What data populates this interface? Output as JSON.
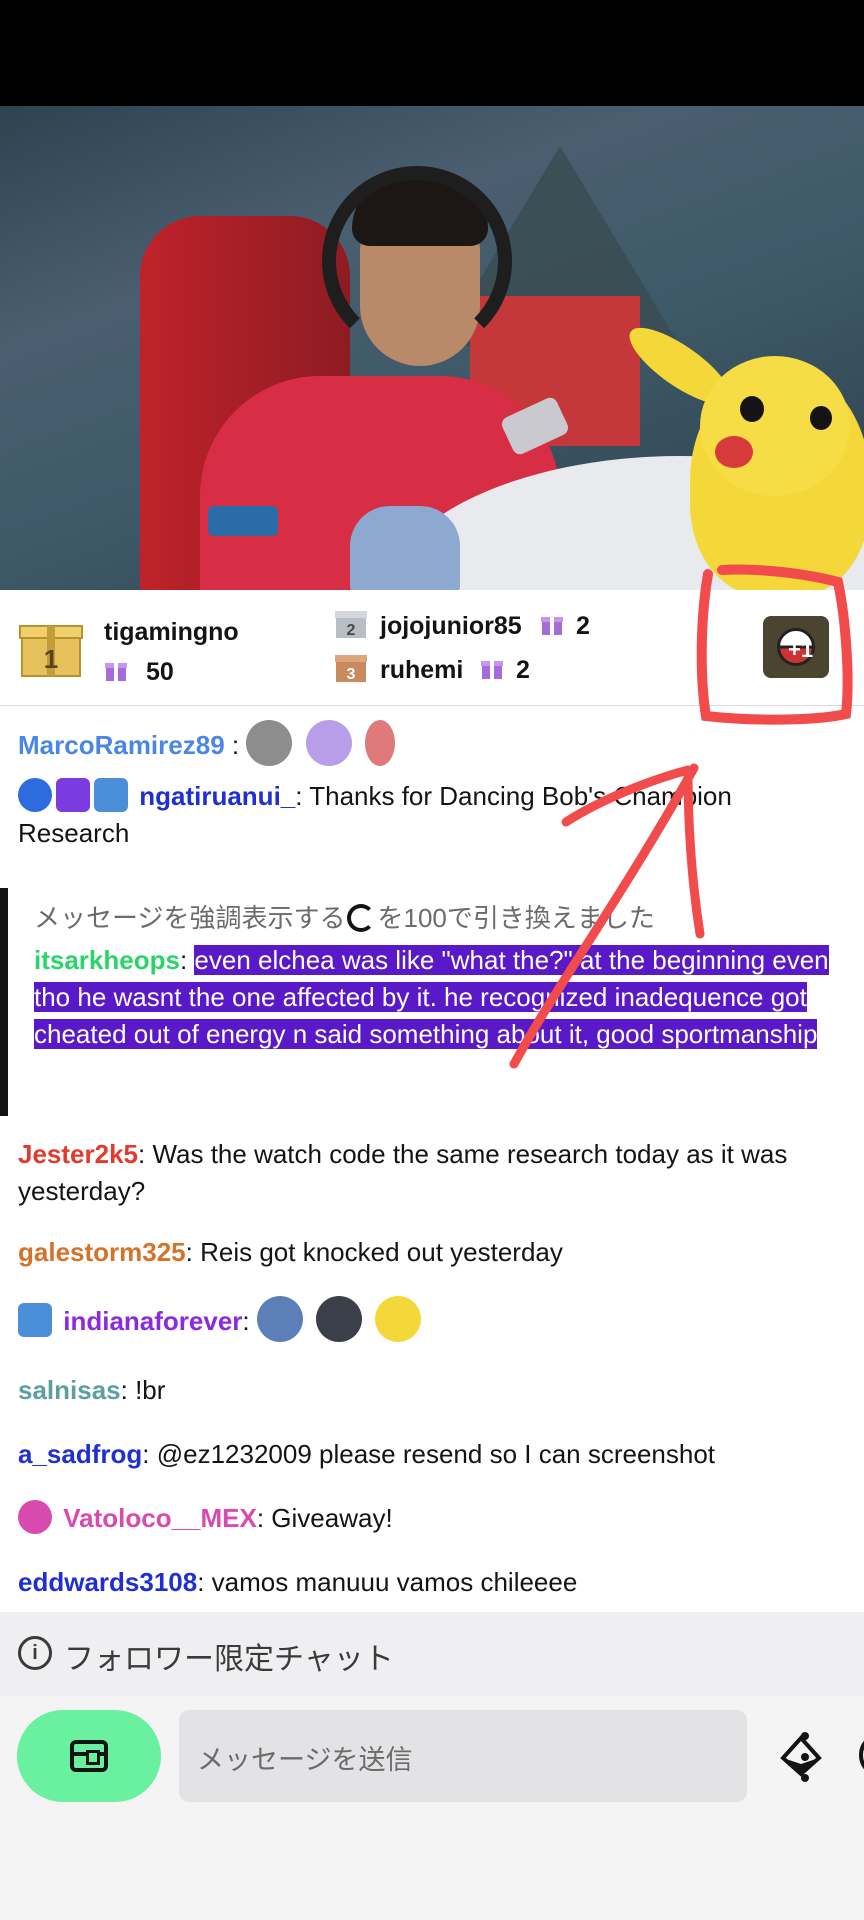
{
  "gift_leaderboard": {
    "first": {
      "rank": "1",
      "user": "tigamingno",
      "count": "50"
    },
    "second": {
      "rank": "2",
      "user": "jojojunior85",
      "count": "2"
    },
    "third": {
      "rank": "3",
      "user": "ruhemi",
      "count": "2"
    },
    "corner_button_label": "+1"
  },
  "chat": {
    "messages": [
      {
        "user": "MarcoRamirez89",
        "user_color": "#4a86e8",
        "text": ""
      },
      {
        "user": "ngatiruanui_",
        "user_color": "#1f2fd4",
        "text": ": Thanks for Dancing Bob's Champion Research"
      },
      {
        "user": "Jester2k5",
        "user_color": "#e23b2e",
        "text": ": Was the watch code the same research today as it was yesterday?"
      },
      {
        "user": "galestorm325",
        "user_color": "#d4732a",
        "text": ": Reis got knocked out yesterday"
      },
      {
        "user": "indianaforever",
        "user_color": "#8a2be2",
        "text": ":"
      },
      {
        "user": "salnisas",
        "user_color": "#5f9ea0",
        "text": ": !br"
      },
      {
        "user": "a_sadfrog",
        "user_color": "#1f2fd4",
        "text": ": @ez1232009 please resend so I can screenshot"
      },
      {
        "user": "Vatoloco__MEX",
        "user_color": "#d94ab0",
        "text": ": Giveaway!"
      },
      {
        "user": "eddwards3108",
        "user_color": "#1f2fd4",
        "text": ": vamos manuuu vamos chileeee"
      }
    ],
    "highlight": {
      "header_before": "メッセージを強調表示する",
      "header_after": "を100で引き換えました",
      "user": "itsarkheops",
      "user_color": "#2bd46a",
      "text": "even elchea was like \"what the?\" at the beginning even tho he wasnt the one affected by it. he recognized inadequence got cheated out of energy n said something about it, good sportmanship"
    }
  },
  "followers_only": {
    "label": "フォロワー限定チャット"
  },
  "input": {
    "placeholder": "メッセージを送信"
  },
  "colors": {
    "accent": "#5a19c9",
    "chest_button": "#69f1a0",
    "annotation": "#f24b4b"
  }
}
